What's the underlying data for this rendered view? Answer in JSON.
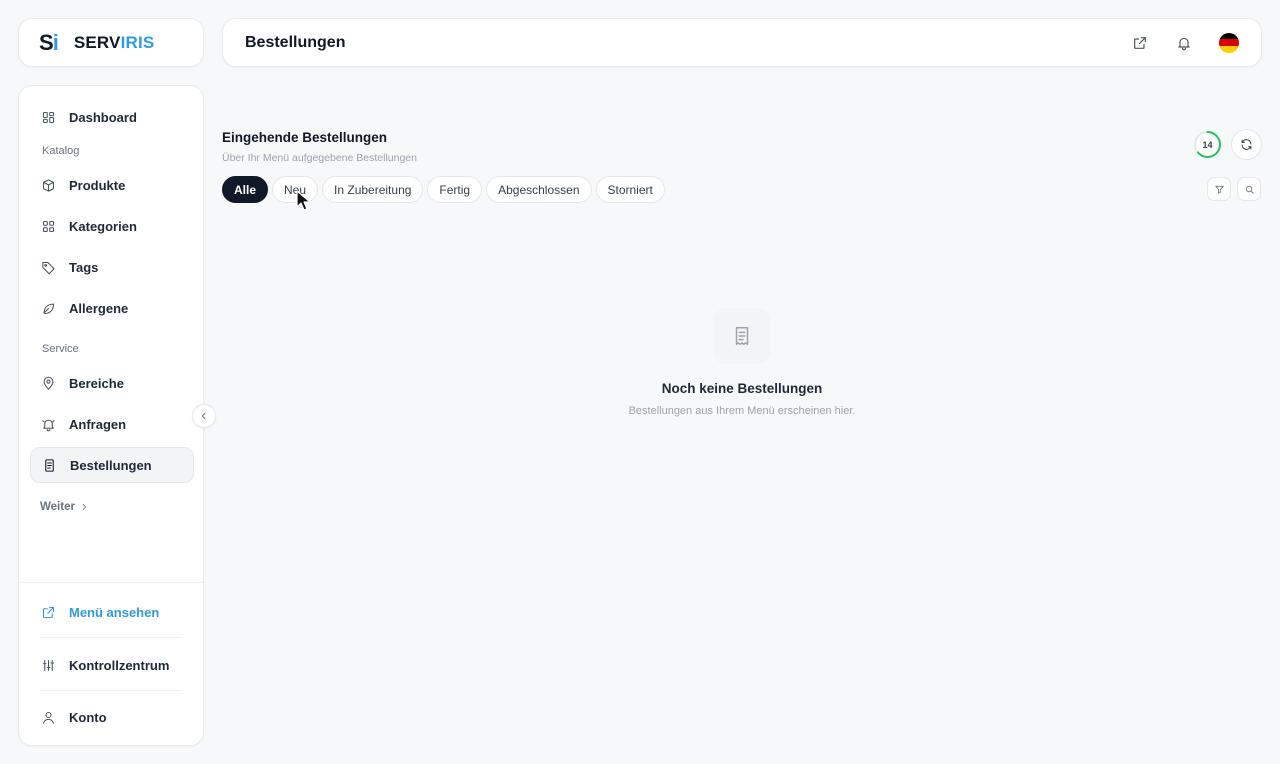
{
  "brand": {
    "mark_s": "S",
    "mark_i": "i",
    "name_part1": "SERV",
    "name_part2": "IRIS",
    "accent_color": "#2f9be0"
  },
  "header": {
    "title": "Bestellungen",
    "actions": [
      {
        "icon": "external-link-icon"
      },
      {
        "icon": "bell-icon"
      },
      {
        "icon": "flag-de-icon"
      }
    ]
  },
  "sidebar": {
    "items": [
      {
        "label": "Dashboard",
        "icon": "dashboard-icon"
      },
      {
        "section": "Katalog"
      },
      {
        "label": "Produkte",
        "icon": "box-icon"
      },
      {
        "label": "Kategorien",
        "icon": "grid-icon"
      },
      {
        "label": "Tags",
        "icon": "tag-icon"
      },
      {
        "label": "Allergene",
        "icon": "leaf-icon"
      },
      {
        "section": "Service"
      },
      {
        "label": "Bereiche",
        "icon": "map-pin-icon"
      },
      {
        "label": "Anfragen",
        "icon": "bell-icon"
      },
      {
        "label": "Bestellungen",
        "icon": "receipt-icon",
        "active": true
      }
    ],
    "more_label": "Weiter",
    "footer": {
      "view_menu": "Menü ansehen",
      "control_center": "Kontrollzentrum",
      "account": "Konto"
    }
  },
  "main": {
    "title": "Eingehende Bestellungen",
    "subtitle": "Über Ihr Menü aufgegebene Bestellungen",
    "counter": 14,
    "counter_color": "#22c55e",
    "tabs": [
      {
        "label": "Alle",
        "active": true
      },
      {
        "label": "Neu"
      },
      {
        "label": "In Zubereitung"
      },
      {
        "label": "Fertig"
      },
      {
        "label": "Abgeschlossen"
      },
      {
        "label": "Storniert"
      }
    ],
    "empty_state": {
      "title": "Noch keine Bestellungen",
      "subtitle": "Bestellungen aus Ihrem Menü erscheinen hier."
    }
  }
}
